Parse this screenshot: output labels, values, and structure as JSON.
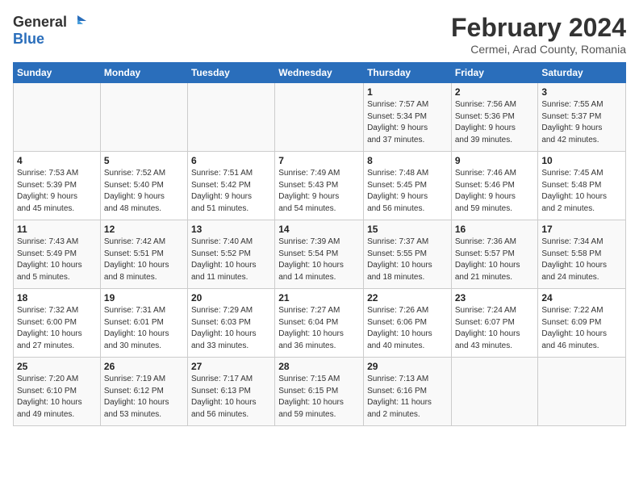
{
  "header": {
    "logo_general": "General",
    "logo_blue": "Blue",
    "title": "February 2024",
    "subtitle": "Cermei, Arad County, Romania"
  },
  "weekdays": [
    "Sunday",
    "Monday",
    "Tuesday",
    "Wednesday",
    "Thursday",
    "Friday",
    "Saturday"
  ],
  "weeks": [
    [
      {
        "day": "",
        "info": ""
      },
      {
        "day": "",
        "info": ""
      },
      {
        "day": "",
        "info": ""
      },
      {
        "day": "",
        "info": ""
      },
      {
        "day": "1",
        "info": "Sunrise: 7:57 AM\nSunset: 5:34 PM\nDaylight: 9 hours\nand 37 minutes."
      },
      {
        "day": "2",
        "info": "Sunrise: 7:56 AM\nSunset: 5:36 PM\nDaylight: 9 hours\nand 39 minutes."
      },
      {
        "day": "3",
        "info": "Sunrise: 7:55 AM\nSunset: 5:37 PM\nDaylight: 9 hours\nand 42 minutes."
      }
    ],
    [
      {
        "day": "4",
        "info": "Sunrise: 7:53 AM\nSunset: 5:39 PM\nDaylight: 9 hours\nand 45 minutes."
      },
      {
        "day": "5",
        "info": "Sunrise: 7:52 AM\nSunset: 5:40 PM\nDaylight: 9 hours\nand 48 minutes."
      },
      {
        "day": "6",
        "info": "Sunrise: 7:51 AM\nSunset: 5:42 PM\nDaylight: 9 hours\nand 51 minutes."
      },
      {
        "day": "7",
        "info": "Sunrise: 7:49 AM\nSunset: 5:43 PM\nDaylight: 9 hours\nand 54 minutes."
      },
      {
        "day": "8",
        "info": "Sunrise: 7:48 AM\nSunset: 5:45 PM\nDaylight: 9 hours\nand 56 minutes."
      },
      {
        "day": "9",
        "info": "Sunrise: 7:46 AM\nSunset: 5:46 PM\nDaylight: 9 hours\nand 59 minutes."
      },
      {
        "day": "10",
        "info": "Sunrise: 7:45 AM\nSunset: 5:48 PM\nDaylight: 10 hours\nand 2 minutes."
      }
    ],
    [
      {
        "day": "11",
        "info": "Sunrise: 7:43 AM\nSunset: 5:49 PM\nDaylight: 10 hours\nand 5 minutes."
      },
      {
        "day": "12",
        "info": "Sunrise: 7:42 AM\nSunset: 5:51 PM\nDaylight: 10 hours\nand 8 minutes."
      },
      {
        "day": "13",
        "info": "Sunrise: 7:40 AM\nSunset: 5:52 PM\nDaylight: 10 hours\nand 11 minutes."
      },
      {
        "day": "14",
        "info": "Sunrise: 7:39 AM\nSunset: 5:54 PM\nDaylight: 10 hours\nand 14 minutes."
      },
      {
        "day": "15",
        "info": "Sunrise: 7:37 AM\nSunset: 5:55 PM\nDaylight: 10 hours\nand 18 minutes."
      },
      {
        "day": "16",
        "info": "Sunrise: 7:36 AM\nSunset: 5:57 PM\nDaylight: 10 hours\nand 21 minutes."
      },
      {
        "day": "17",
        "info": "Sunrise: 7:34 AM\nSunset: 5:58 PM\nDaylight: 10 hours\nand 24 minutes."
      }
    ],
    [
      {
        "day": "18",
        "info": "Sunrise: 7:32 AM\nSunset: 6:00 PM\nDaylight: 10 hours\nand 27 minutes."
      },
      {
        "day": "19",
        "info": "Sunrise: 7:31 AM\nSunset: 6:01 PM\nDaylight: 10 hours\nand 30 minutes."
      },
      {
        "day": "20",
        "info": "Sunrise: 7:29 AM\nSunset: 6:03 PM\nDaylight: 10 hours\nand 33 minutes."
      },
      {
        "day": "21",
        "info": "Sunrise: 7:27 AM\nSunset: 6:04 PM\nDaylight: 10 hours\nand 36 minutes."
      },
      {
        "day": "22",
        "info": "Sunrise: 7:26 AM\nSunset: 6:06 PM\nDaylight: 10 hours\nand 40 minutes."
      },
      {
        "day": "23",
        "info": "Sunrise: 7:24 AM\nSunset: 6:07 PM\nDaylight: 10 hours\nand 43 minutes."
      },
      {
        "day": "24",
        "info": "Sunrise: 7:22 AM\nSunset: 6:09 PM\nDaylight: 10 hours\nand 46 minutes."
      }
    ],
    [
      {
        "day": "25",
        "info": "Sunrise: 7:20 AM\nSunset: 6:10 PM\nDaylight: 10 hours\nand 49 minutes."
      },
      {
        "day": "26",
        "info": "Sunrise: 7:19 AM\nSunset: 6:12 PM\nDaylight: 10 hours\nand 53 minutes."
      },
      {
        "day": "27",
        "info": "Sunrise: 7:17 AM\nSunset: 6:13 PM\nDaylight: 10 hours\nand 56 minutes."
      },
      {
        "day": "28",
        "info": "Sunrise: 7:15 AM\nSunset: 6:15 PM\nDaylight: 10 hours\nand 59 minutes."
      },
      {
        "day": "29",
        "info": "Sunrise: 7:13 AM\nSunset: 6:16 PM\nDaylight: 11 hours\nand 2 minutes."
      },
      {
        "day": "",
        "info": ""
      },
      {
        "day": "",
        "info": ""
      }
    ]
  ]
}
